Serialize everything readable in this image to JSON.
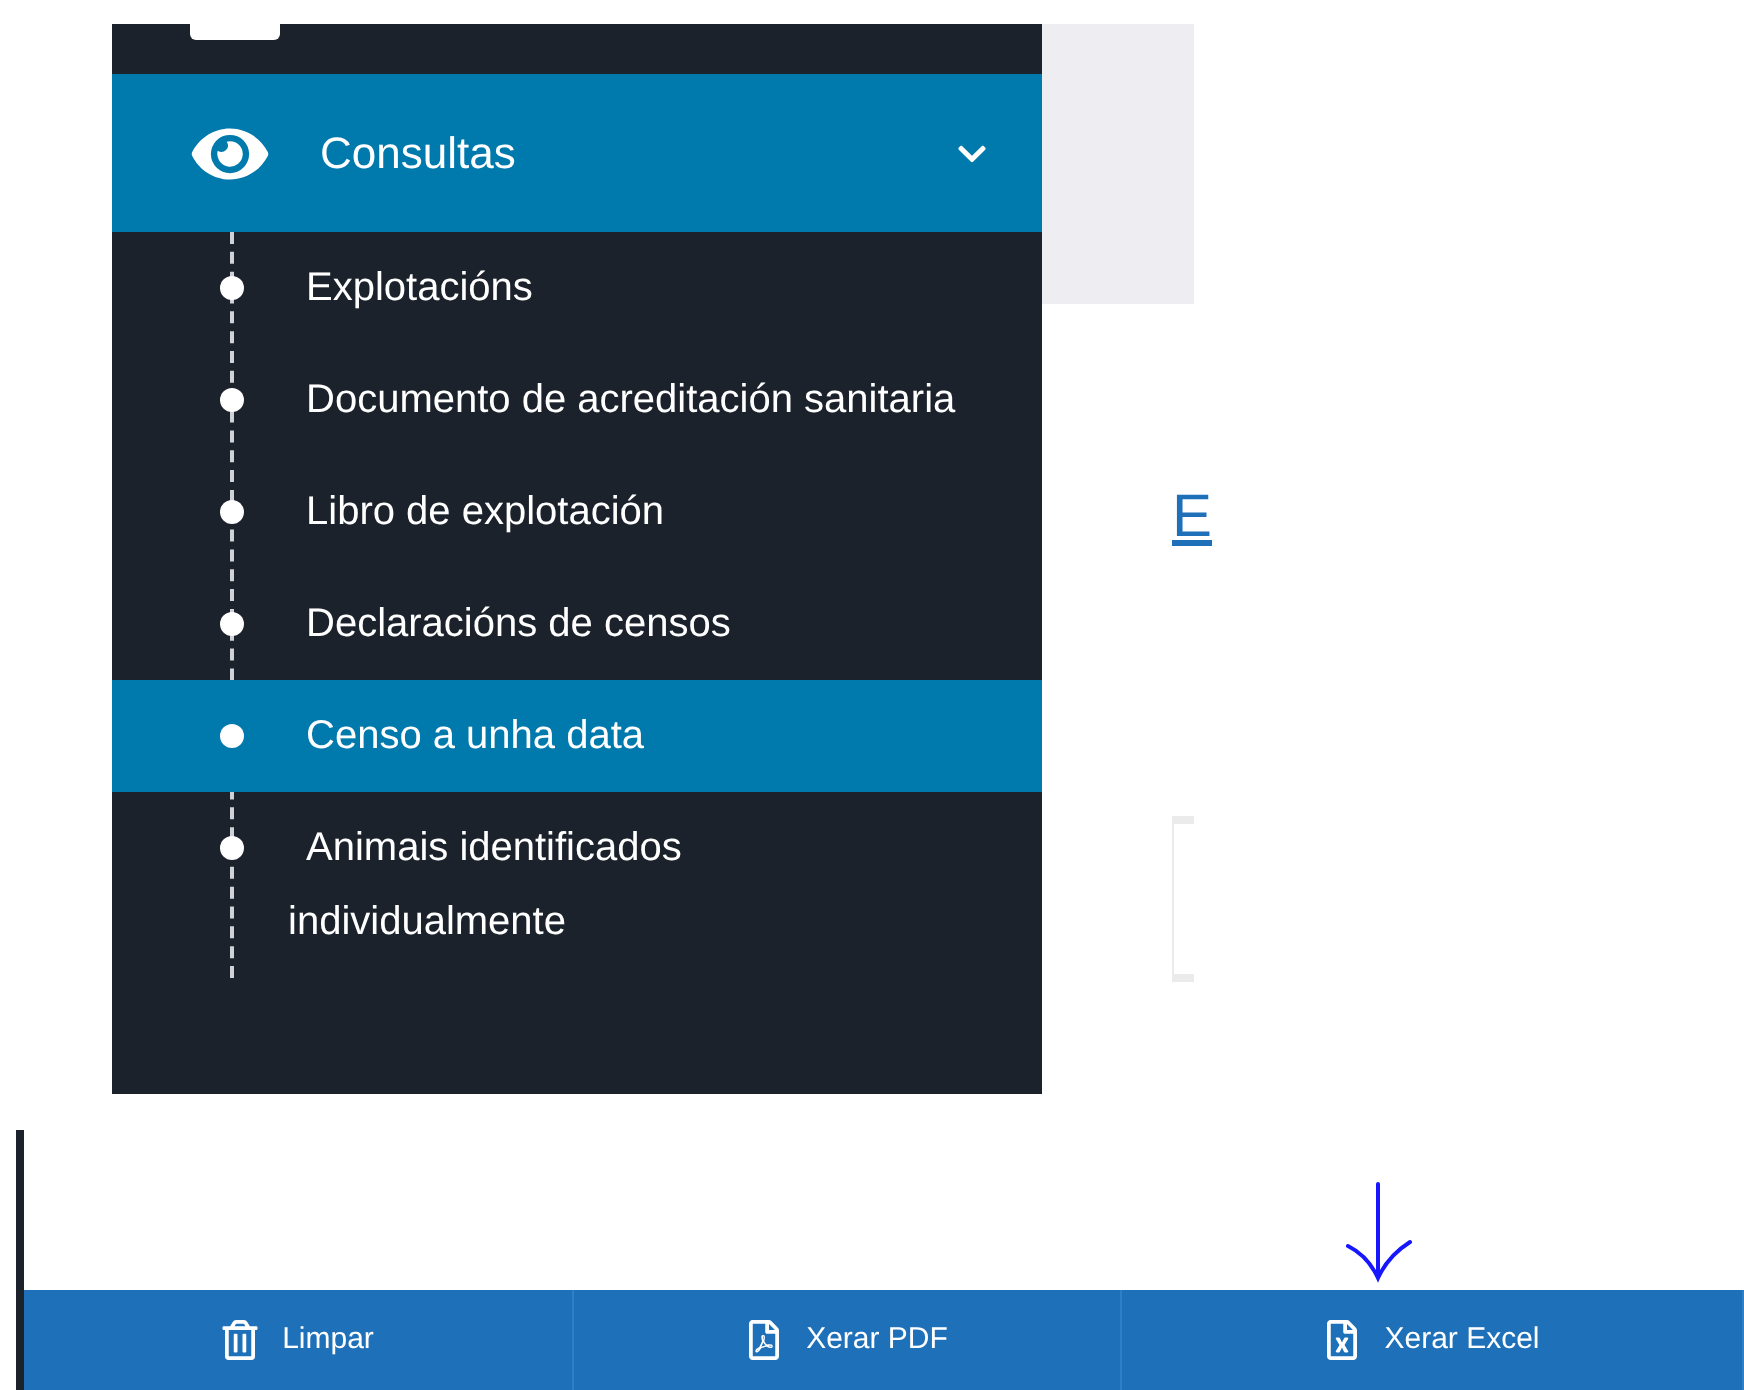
{
  "sidebar": {
    "section": {
      "label": "Consultas",
      "expanded": true,
      "selected": true
    },
    "items": [
      {
        "label": "Explotacións",
        "selected": false
      },
      {
        "label": "Documento de acreditación sanitaria",
        "selected": false
      },
      {
        "label": "Libro de explotación",
        "selected": false
      },
      {
        "label": "Declaracións de censos",
        "selected": false
      },
      {
        "label": "Censo a unha data",
        "selected": true
      },
      {
        "label": "Animais identificados individualmente",
        "selected": false
      }
    ]
  },
  "content": {
    "link": "E"
  },
  "toolbar": {
    "buttons": [
      {
        "kind": "clear",
        "label": "Limpar"
      },
      {
        "kind": "pdf",
        "label": "Xerar PDF"
      },
      {
        "kind": "excel",
        "label": "Xerar Excel"
      }
    ]
  }
}
